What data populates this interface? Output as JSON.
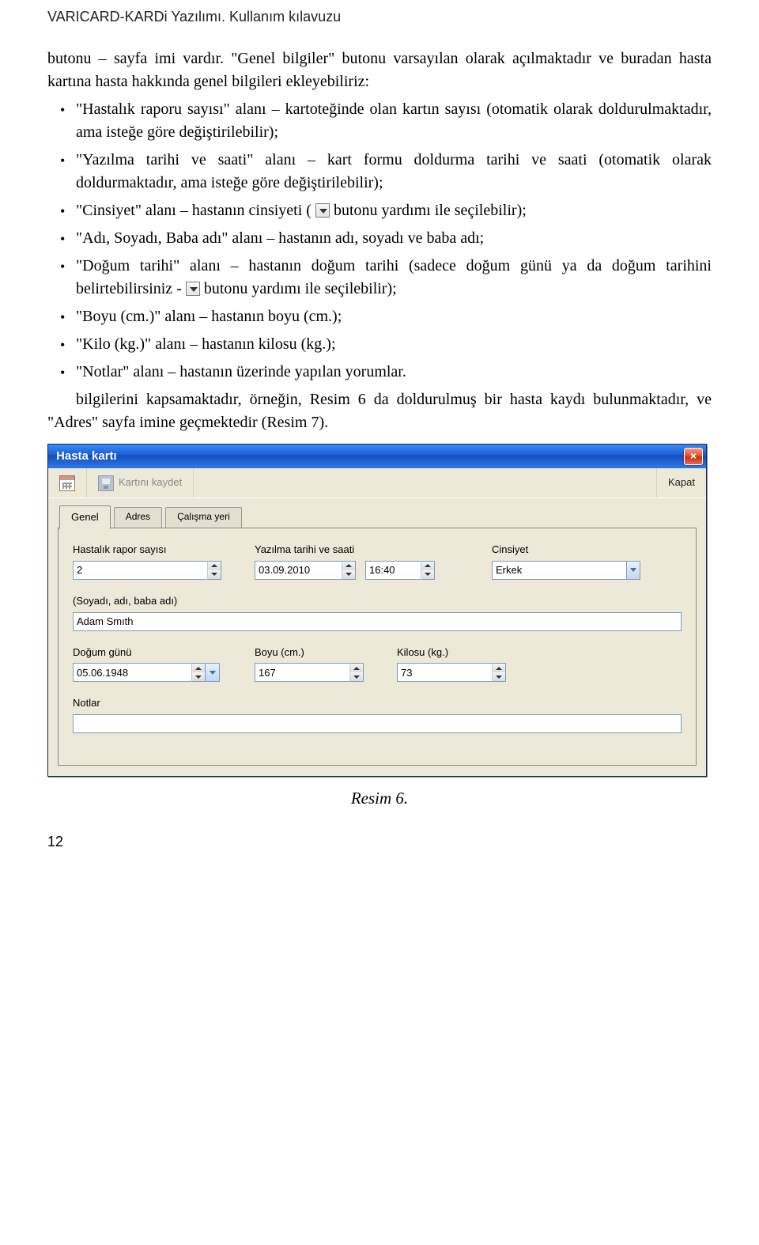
{
  "header": "VARICARD-KARDi Yazılımı. Kullanım kılavuzu",
  "intro_para": "butonu – sayfa imi vardır. \"Genel bilgiler\" butonu varsayılan olarak açılmaktadır ve buradan hasta kartına hasta hakkında genel bilgileri ekleyebiliriz:",
  "bullets": {
    "b1": "\"Hastalık raporu sayısı\" alanı – kartoteğinde olan kartın sayısı (otomatik olarak doldurulmaktadır, ama isteğe göre değiştirilebilir);",
    "b2": "\"Yazılma tarihi ve saati\" alanı – kart formu doldurma tarihi ve saati (otomatik olarak doldurmaktadır, ama isteğe göre değiştirilebilir);",
    "b3_prefix": "\"Cinsiyet\" alanı – hastanın cinsiyeti (",
    "b3_suffix": " butonu yardımı ile seçilebilir);",
    "b4": "\"Adı, Soyadı, Baba adı\" alanı – hastanın adı, soyadı ve baba adı;",
    "b5_prefix": "\"Doğum tarihi\" alanı – hastanın doğum tarihi (sadece doğum günü ya da doğum tarihini belirtebilirsiniz - ",
    "b5_suffix": " butonu yardımı ile seçilebilir);",
    "b6": "\"Boyu (cm.)\" alanı – hastanın boyu (cm.);",
    "b7": "\"Kilo (kg.)\" alanı – hastanın kilosu (kg.);",
    "b8": "\"Notlar\" alanı – hastanın üzerinde yapılan yorumlar."
  },
  "after_para": "bilgilerini kapsamaktadır, örneğin, Resim 6 da doldurulmuş bir hasta kaydı bulunmaktadır, ve \"Adres\" sayfa imine geçmektedir (Resim 7).",
  "dialog": {
    "title": "Hasta kartı",
    "toolbar": {
      "save_label": "Kartını kaydet",
      "close_label": "Kapat"
    },
    "tabs": {
      "t1": "Genel",
      "t2": "Adres",
      "t3": "Çalışma yeri"
    },
    "fields": {
      "report_label": "Hastalık rapor sayısı",
      "report_value": "2",
      "datetime_label": "Yazılma tarihi ve saati",
      "date_value": "03.09.2010",
      "time_value": "16:40",
      "gender_label": "Cinsiyet",
      "gender_value": "Erkek",
      "name_label": "(Soyadı, adı, baba adı)",
      "name_value": "Adam Smıth",
      "bday_label": "Doğum günü",
      "bday_value": "05.06.1948",
      "height_label": "Boyu (cm.)",
      "height_value": "167",
      "weight_label": "Kilosu (kg.)",
      "weight_value": "73",
      "notes_label": "Notlar",
      "notes_value": ""
    }
  },
  "figure_caption": "Resim 6.",
  "page_number": "12"
}
